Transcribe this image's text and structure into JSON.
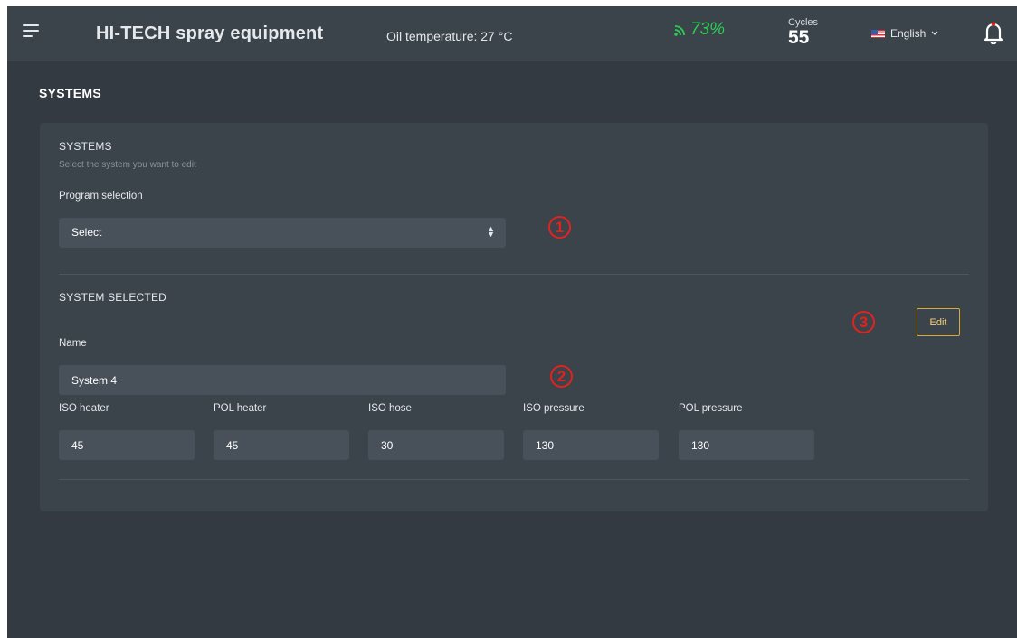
{
  "header": {
    "title": "HI-TECH spray equipment",
    "oil_temperature": "Oil temperature: 27 °C",
    "signal_percent": "73%",
    "cycles_label": "Cycles",
    "cycles_value": "55",
    "language": "English"
  },
  "page": {
    "title": "SYSTEMS"
  },
  "systems_section": {
    "title": "SYSTEMS",
    "hint": "Select the system you want to edit",
    "program_label": "Program selection",
    "select_value": "Select"
  },
  "selected_section": {
    "title": "SYSTEM SELECTED",
    "edit_label": "Edit",
    "name_label": "Name",
    "name_value": "System 4",
    "fields": [
      {
        "label": "ISO heater",
        "value": "45"
      },
      {
        "label": "POL heater",
        "value": "45"
      },
      {
        "label": "ISO hose",
        "value": "30"
      },
      {
        "label": "ISO pressure",
        "value": "130"
      },
      {
        "label": "POL pressure",
        "value": "130"
      }
    ]
  },
  "annotations": [
    "1",
    "2",
    "3"
  ],
  "colors": {
    "accent_green": "#2ecc55",
    "edit_border": "#d8aa36",
    "annotation_red": "#e0231f",
    "background": "#343a41",
    "panel": "#3b434b"
  },
  "icons": [
    "menu-icon",
    "signal-icon",
    "flag-icon",
    "chevron-down-icon",
    "bell-icon",
    "select-arrows-icon"
  ]
}
